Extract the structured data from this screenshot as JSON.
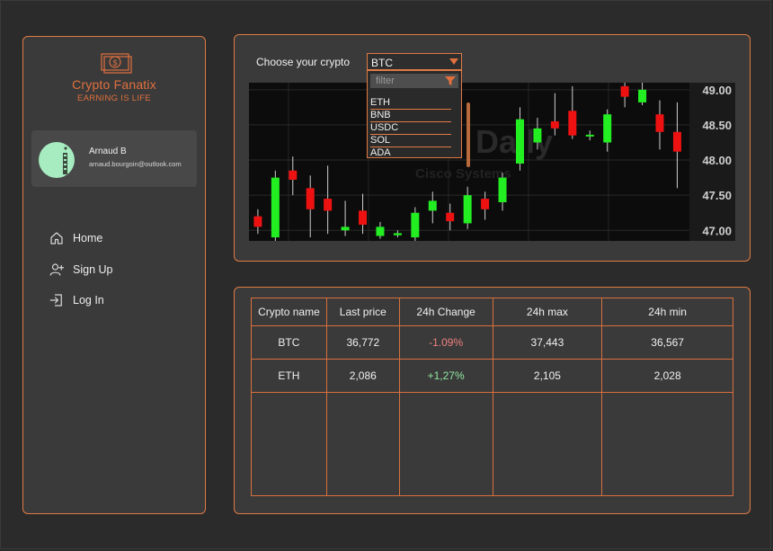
{
  "brand": {
    "name": "Crypto Fanatix",
    "tagline": "EARNING IS LIFE",
    "accent": "#e0703d"
  },
  "user": {
    "name": "Arnaud B",
    "email": "arnaud.bourgoin@outlook.com"
  },
  "nav": [
    {
      "label": "Home",
      "icon": "home-icon"
    },
    {
      "label": "Sign Up",
      "icon": "user-plus-icon"
    },
    {
      "label": "Log In",
      "icon": "log-in-icon"
    }
  ],
  "chart_panel": {
    "choose_label": "Choose your crypto",
    "selected": "BTC",
    "filter_placeholder": "filter",
    "options": [
      "ETH",
      "BNB",
      "USDC",
      "SOL",
      "ADA"
    ],
    "watermark_title": "Daily",
    "watermark_sub": "Cisco Systems"
  },
  "chart_data": {
    "type": "candlestick",
    "y_ticks": [
      "47.00",
      "47.50",
      "48.00",
      "48.50",
      "49.00"
    ],
    "ylim": [
      46.85,
      49.1
    ],
    "colors": {
      "up": "#22ee22",
      "down": "#ee1111",
      "wick": "#cfcfcf"
    },
    "candles": [
      {
        "o": 47.2,
        "c": 47.05,
        "h": 47.3,
        "l": 46.95
      },
      {
        "o": 46.9,
        "c": 47.75,
        "h": 47.85,
        "l": 46.85
      },
      {
        "o": 47.85,
        "c": 47.72,
        "h": 48.05,
        "l": 47.5
      },
      {
        "o": 47.6,
        "c": 47.3,
        "h": 47.78,
        "l": 46.9
      },
      {
        "o": 47.45,
        "c": 47.28,
        "h": 47.92,
        "l": 46.95
      },
      {
        "o": 47.0,
        "c": 47.05,
        "h": 47.42,
        "l": 46.92
      },
      {
        "o": 47.28,
        "c": 47.08,
        "h": 47.52,
        "l": 46.95
      },
      {
        "o": 46.92,
        "c": 47.05,
        "h": 47.12,
        "l": 46.88
      },
      {
        "o": 46.93,
        "c": 46.96,
        "h": 47.0,
        "l": 46.9
      },
      {
        "o": 46.9,
        "c": 47.25,
        "h": 47.33,
        "l": 46.85
      },
      {
        "o": 47.28,
        "c": 47.42,
        "h": 47.55,
        "l": 47.1
      },
      {
        "o": 47.25,
        "c": 47.13,
        "h": 47.38,
        "l": 47.0
      },
      {
        "o": 47.1,
        "c": 47.5,
        "h": 47.62,
        "l": 47.02
      },
      {
        "o": 47.45,
        "c": 47.3,
        "h": 47.55,
        "l": 47.15
      },
      {
        "o": 47.4,
        "c": 47.75,
        "h": 47.82,
        "l": 47.28
      },
      {
        "o": 47.95,
        "c": 48.58,
        "h": 48.75,
        "l": 47.85
      },
      {
        "o": 48.25,
        "c": 48.45,
        "h": 48.6,
        "l": 48.15
      },
      {
        "o": 48.55,
        "c": 48.45,
        "h": 48.95,
        "l": 48.35
      },
      {
        "o": 48.7,
        "c": 48.35,
        "h": 49.05,
        "l": 48.3
      },
      {
        "o": 48.35,
        "c": 48.36,
        "h": 48.42,
        "l": 48.28
      },
      {
        "o": 48.25,
        "c": 48.65,
        "h": 48.72,
        "l": 48.12
      },
      {
        "o": 49.05,
        "c": 48.9,
        "h": 49.1,
        "l": 48.75
      },
      {
        "o": 48.82,
        "c": 49.0,
        "h": 49.1,
        "l": 48.78
      },
      {
        "o": 48.65,
        "c": 48.4,
        "h": 48.85,
        "l": 48.15
      },
      {
        "o": 48.4,
        "c": 48.12,
        "h": 48.82,
        "l": 47.6
      }
    ]
  },
  "table": {
    "headers": [
      "Crypto name",
      "Last price",
      "24h Change",
      "24h max",
      "24h min"
    ],
    "rows": [
      {
        "name": "BTC",
        "last": "36,772",
        "change": "-1.09%",
        "max": "37,443",
        "min": "36,567"
      },
      {
        "name": "ETH",
        "last": "2,086",
        "change": "+1,27%",
        "max": "2,105",
        "min": "2,028"
      }
    ]
  }
}
